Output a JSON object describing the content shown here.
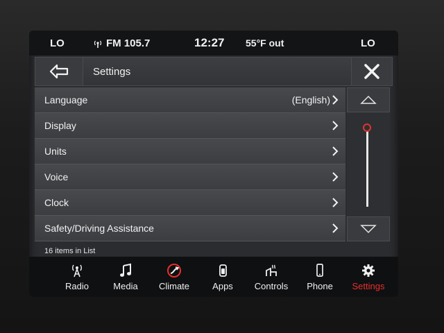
{
  "status": {
    "lo_left": "LO",
    "radio": "FM 105.7",
    "time": "12:27",
    "temperature": "55°F out",
    "lo_right": "LO"
  },
  "header": {
    "title": "Settings"
  },
  "list": {
    "items": [
      {
        "label": "Language",
        "value": "(English)"
      },
      {
        "label": "Display",
        "value": ""
      },
      {
        "label": "Units",
        "value": ""
      },
      {
        "label": "Voice",
        "value": ""
      },
      {
        "label": "Clock",
        "value": ""
      },
      {
        "label": "Safety/Driving Assistance",
        "value": ""
      }
    ],
    "count_text": "16 items in List",
    "scroll_position": 0
  },
  "nav": {
    "items": [
      {
        "label": "Radio",
        "icon": "radio-icon"
      },
      {
        "label": "Media",
        "icon": "music-note-icon"
      },
      {
        "label": "Climate",
        "icon": "climate-icon"
      },
      {
        "label": "Apps",
        "icon": "apps-icon"
      },
      {
        "label": "Controls",
        "icon": "controls-icon"
      },
      {
        "label": "Phone",
        "icon": "phone-icon"
      },
      {
        "label": "Settings",
        "icon": "gear-icon"
      }
    ],
    "active": "Settings",
    "active_color": "#e8302b"
  }
}
